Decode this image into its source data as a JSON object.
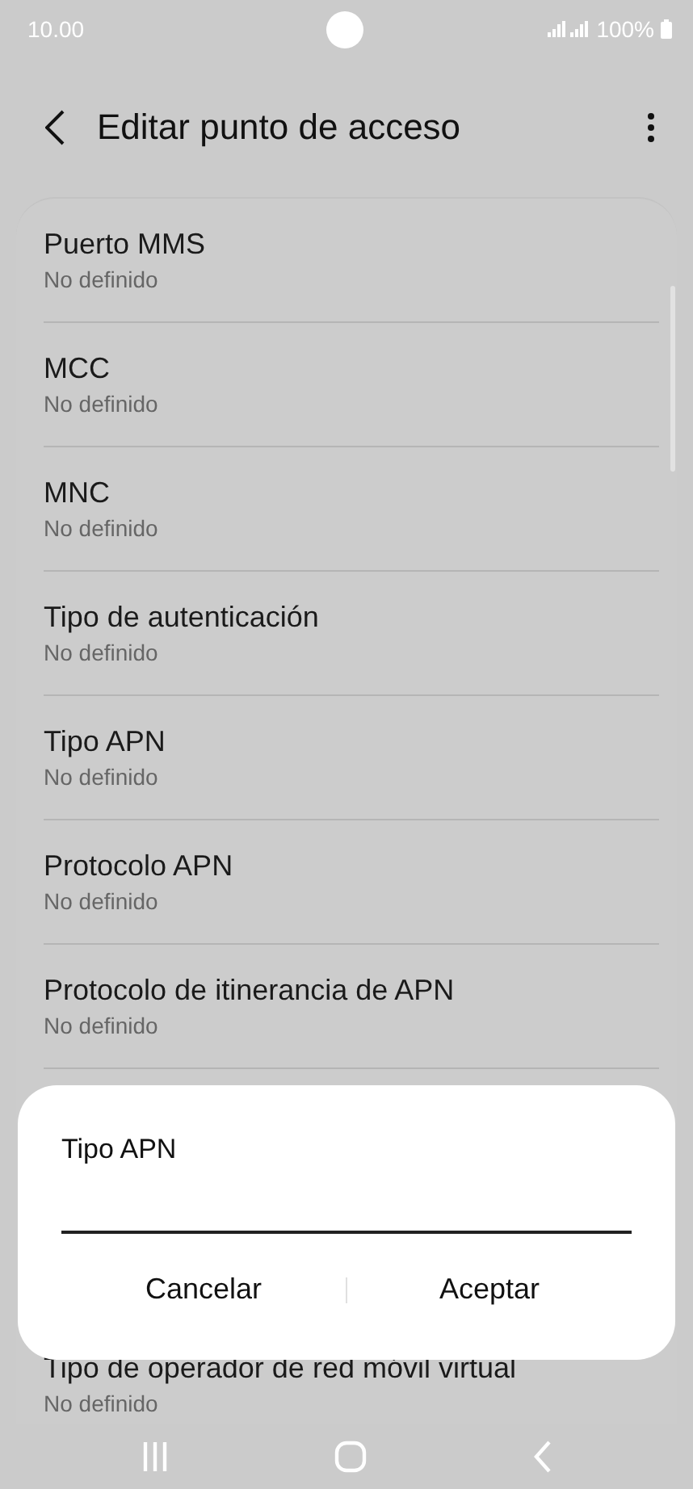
{
  "status_bar": {
    "time": "10.00",
    "battery": "100%"
  },
  "header": {
    "title": "Editar punto de acceso"
  },
  "settings": [
    {
      "title": "Puerto MMS",
      "value": "No definido"
    },
    {
      "title": "MCC",
      "value": "No definido"
    },
    {
      "title": "MNC",
      "value": "No definido"
    },
    {
      "title": "Tipo de autenticación",
      "value": "No definido"
    },
    {
      "title": "Tipo APN",
      "value": "No definido"
    },
    {
      "title": "Protocolo APN",
      "value": "No definido"
    },
    {
      "title": "Protocolo de itinerancia de APN",
      "value": "No definido"
    },
    {
      "title": "Tipo de operador de red móvil virtual",
      "value": "No definido"
    }
  ],
  "dialog": {
    "title": "Tipo APN",
    "buttons": [
      "Cancelar",
      "Aceptar"
    ]
  }
}
